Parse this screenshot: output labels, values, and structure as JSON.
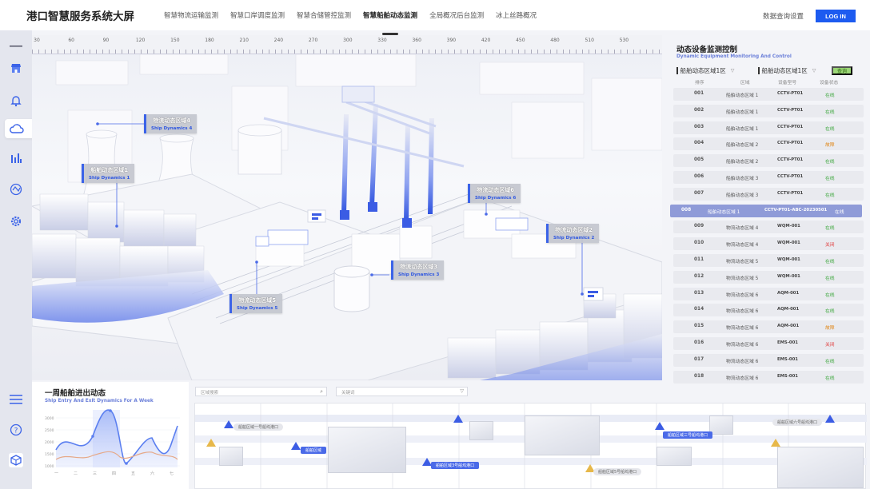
{
  "app": {
    "title": "港口智慧服务系统大屏"
  },
  "nav": {
    "items": [
      "智慧物流运输监测",
      "智慧口岸调度监测",
      "智慧合储管控监测",
      "智慧船舶动态监测",
      "全局概况后台监测",
      "冰上丝路概况"
    ],
    "active_index": 3
  },
  "header": {
    "settings_link": "数据查询设置",
    "login_label": "LOG IN"
  },
  "sidebar": {
    "icons": [
      "menu-icon",
      "store-icon",
      "bell-icon",
      "cloud-icon",
      "chart-bars-icon",
      "network-icon",
      "gear-icon",
      "list-icon",
      "help-icon",
      "cube-icon"
    ],
    "active": "cloud-icon"
  },
  "ruler": {
    "labels": [
      "30",
      "60",
      "90",
      "120",
      "150",
      "180",
      "210",
      "240",
      "270",
      "300",
      "330",
      "360",
      "390",
      "420",
      "450",
      "480",
      "510",
      "530"
    ]
  },
  "scene": {
    "labels": [
      {
        "zh": "物流动态区域4",
        "en": "Ship Dynamics 4"
      },
      {
        "zh": "船舶动态区域1",
        "en": "Ship Dynamics 1"
      },
      {
        "zh": "物流动态区域6",
        "en": "Ship Dynamics 6"
      },
      {
        "zh": "物流动态区域2",
        "en": "Ship Dynamics 2"
      },
      {
        "zh": "物流动态区域3",
        "en": "Ship Dynamics 3"
      },
      {
        "zh": "物流动态区域5",
        "en": "Ship Dynamics 5"
      }
    ]
  },
  "panel": {
    "title": "动态设备监测控制",
    "subtitle": "Dynamic Equipment Monitoring And Control",
    "filter1": "船舶动态区域1区",
    "filter2": "船舶动态区域1区",
    "query_label": "查询",
    "columns": [
      "排序",
      "区域",
      "设备型号",
      "设备状态"
    ],
    "status_colors": {
      "在线": "#3aa63a",
      "故障": "#e08a1e",
      "关闭": "#e03a3a"
    },
    "rows": [
      [
        "001",
        "船舶动态区域 1",
        "CCTV-PT01",
        "在线"
      ],
      [
        "002",
        "船舶动态区域 1",
        "CCTV-PT01",
        "在线"
      ],
      [
        "003",
        "船舶动态区域 1",
        "CCTV-PT01",
        "在线"
      ],
      [
        "004",
        "船舶动态区域 2",
        "CCTV-PT01",
        "故障"
      ],
      [
        "005",
        "船舶动态区域 2",
        "CCTV-PT01",
        "在线"
      ],
      [
        "006",
        "船舶动态区域 3",
        "CCTV-PT01",
        "在线"
      ],
      [
        "007",
        "船舶动态区域 3",
        "CCTV-PT01",
        "在线"
      ],
      [
        "008",
        "船舶动态区域 1",
        "CCTV-PT01-ABC-20230501",
        "在线"
      ],
      [
        "009",
        "物流动态区域 4",
        "WQM-001",
        "在线"
      ],
      [
        "010",
        "物流动态区域 4",
        "WQM-001",
        "关闭"
      ],
      [
        "011",
        "物流动态区域 5",
        "WQM-001",
        "在线"
      ],
      [
        "012",
        "物流动态区域 5",
        "WQM-001",
        "在线"
      ],
      [
        "013",
        "物流动态区域 6",
        "AQM-001",
        "在线"
      ],
      [
        "014",
        "物流动态区域 6",
        "AQM-001",
        "在线"
      ],
      [
        "015",
        "物流动态区域 6",
        "AQM-001",
        "故障"
      ],
      [
        "016",
        "物流动态区域 6",
        "EMS-001",
        "关闭"
      ],
      [
        "017",
        "物流动态区域 6",
        "EMS-001",
        "在线"
      ],
      [
        "018",
        "物流动态区域 6",
        "EMS-001",
        "在线"
      ]
    ],
    "highlight_index": 7
  },
  "weekly": {
    "title": "一周船舶进出动态",
    "subtitle": "Ship Entry And Exit Dynamics For A Week",
    "y_ticks": [
      "3000",
      "2500",
      "2000",
      "1500",
      "1000"
    ],
    "x_ticks": [
      "一",
      "二",
      "三",
      "四",
      "五",
      "六",
      "七"
    ]
  },
  "timeline": {
    "search1_placeholder": "区域搜索",
    "search2_placeholder": "关键词",
    "tags": [
      {
        "text": "船舶区域一号船坞港口",
        "style": "gray"
      },
      {
        "text": "船舶区域",
        "style": "blue"
      },
      {
        "text": "船舶区域3号船坞港口",
        "style": "blue"
      },
      {
        "text": "船舶区域5号船坞港口",
        "style": "gray"
      },
      {
        "text": "船舶区域三号船坞港口",
        "style": "blue"
      },
      {
        "text": "船舶区域六号船坞港口",
        "style": "gray"
      }
    ]
  }
}
